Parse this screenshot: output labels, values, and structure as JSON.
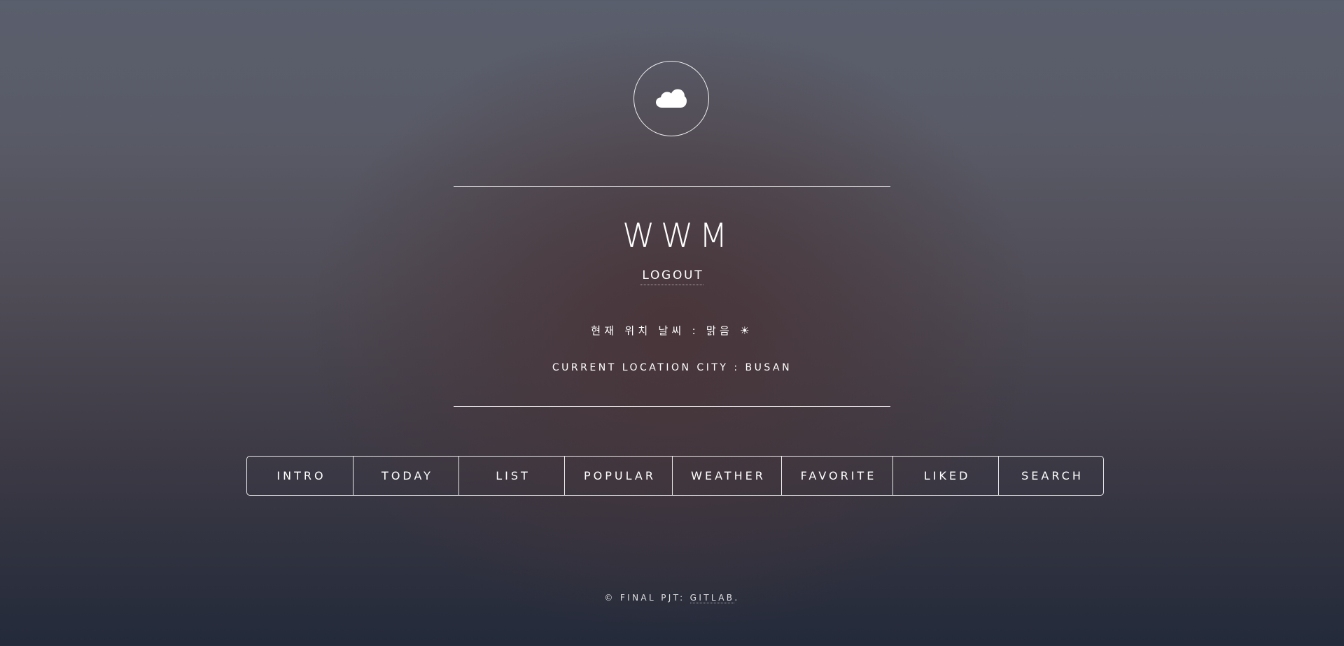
{
  "header": {
    "logo_icon": "cloud-icon",
    "title": "WWM",
    "logout_label": "LOGOUT"
  },
  "weather": {
    "status_text": "현재 위치 날씨 : 맑음 ☀",
    "city_text": "CURRENT LOCATION CITY : BUSAN"
  },
  "nav": {
    "items": [
      {
        "label": "INTRO"
      },
      {
        "label": "TODAY"
      },
      {
        "label": "LIST"
      },
      {
        "label": "POPULAR"
      },
      {
        "label": "WEATHER"
      },
      {
        "label": "FAVORITE"
      },
      {
        "label": "LIKED"
      },
      {
        "label": "SEARCH"
      }
    ]
  },
  "footer": {
    "prefix": "© FINAL PJT: ",
    "link_label": "GITLAB",
    "suffix": "."
  },
  "colors": {
    "text": "#ffffff",
    "background_top": "#5a5f6d",
    "background_bottom": "#232a3a"
  }
}
